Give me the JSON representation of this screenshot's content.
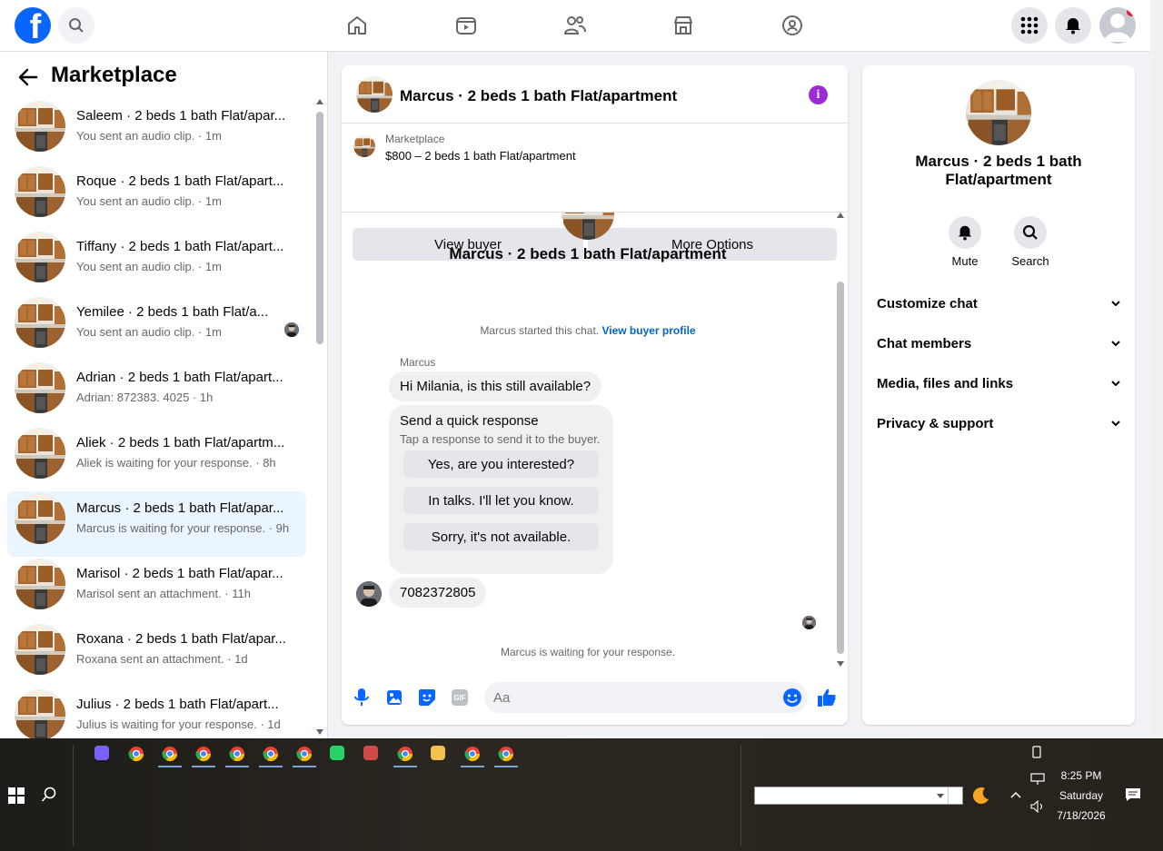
{
  "nav": {
    "logo_letter": "f",
    "icons": [
      "home-icon",
      "watch-icon",
      "friends-icon",
      "marketplace-icon",
      "groups-icon"
    ],
    "right_icons": [
      "menu-grid-icon",
      "notifications-icon",
      "account-icon"
    ]
  },
  "left": {
    "title": "Marketplace",
    "conversations": [
      {
        "title": "Saleem · 2 beds 1 bath Flat/apar...",
        "subtitle": "You sent an audio clip. · 1m",
        "active": false
      },
      {
        "title": "Roque · 2 beds 1 bath Flat/apart...",
        "subtitle": "You sent an audio clip. · 1m",
        "active": false
      },
      {
        "title": "Tiffany · 2 beds 1 bath Flat/apart...",
        "subtitle": "You sent an audio clip. · 1m",
        "active": false
      },
      {
        "title": "Yemilee · 2 beds 1 bath Flat/a...",
        "subtitle": "You sent an audio clip. · 1m",
        "active": false
      },
      {
        "title": "Adrian · 2 beds 1 bath Flat/apart...",
        "subtitle": "Adrian: 872383. 4025 · 1h",
        "active": false
      },
      {
        "title": "Aliek · 2 beds 1 bath Flat/apartm...",
        "subtitle": "Aliek is waiting for your response. · 8h",
        "active": false
      },
      {
        "title": "Marcus · 2 beds 1 bath Flat/apar...",
        "subtitle": "Marcus is waiting for your response. · 9h",
        "active": true
      },
      {
        "title": "Marisol · 2 beds 1 bath Flat/apar...",
        "subtitle": "Marisol sent an attachment. · 11h",
        "active": false
      },
      {
        "title": "Roxana · 2 beds 1 bath Flat/apar...",
        "subtitle": "Roxana sent an attachment. · 1d",
        "active": false
      },
      {
        "title": "Julius · 2 beds 1 bath Flat/apart...",
        "subtitle": "Julius is waiting for your response. · 1d",
        "active": false
      }
    ]
  },
  "chat": {
    "header_title": "Marcus · 2 beds 1 bath Flat/apartment",
    "marketplace_label": "Marketplace",
    "listing": "$800 – 2 beds 1 bath Flat/apartment",
    "view_buyer": "View buyer",
    "more_options": "More Options",
    "conversation_name": "Marcus · 2 beds 1 bath Flat/apartment",
    "started_text": "Marcus started this chat.",
    "view_buyer_profile": "View buyer profile",
    "sender": "Marcus",
    "first_message": "Hi Milania, is this still available?",
    "quick_title": "Send a quick response",
    "quick_sub": "Tap a response to send it to the buyer.",
    "quick_responses": [
      "Yes, are you interested?",
      "In talks. I'll let you know.",
      "Sorry, it's not available."
    ],
    "phone_message": "7082372805",
    "waiting": "Marcus is waiting for your response.",
    "input_placeholder": "Aa",
    "gif_label": "GIF"
  },
  "info": {
    "name": "Marcus · 2 beds 1 bath Flat/apartment",
    "mute": "Mute",
    "search": "Search",
    "sections": [
      "Customize chat",
      "Chat members",
      "Media, files and links",
      "Privacy & support"
    ]
  },
  "taskbar": {
    "time": "8:25 PM",
    "day": "Saturday",
    "date": "7/18/2026"
  },
  "colors": {
    "accent": "#0866ff",
    "link": "#0064d1",
    "active_bg": "#ebf5ff"
  }
}
